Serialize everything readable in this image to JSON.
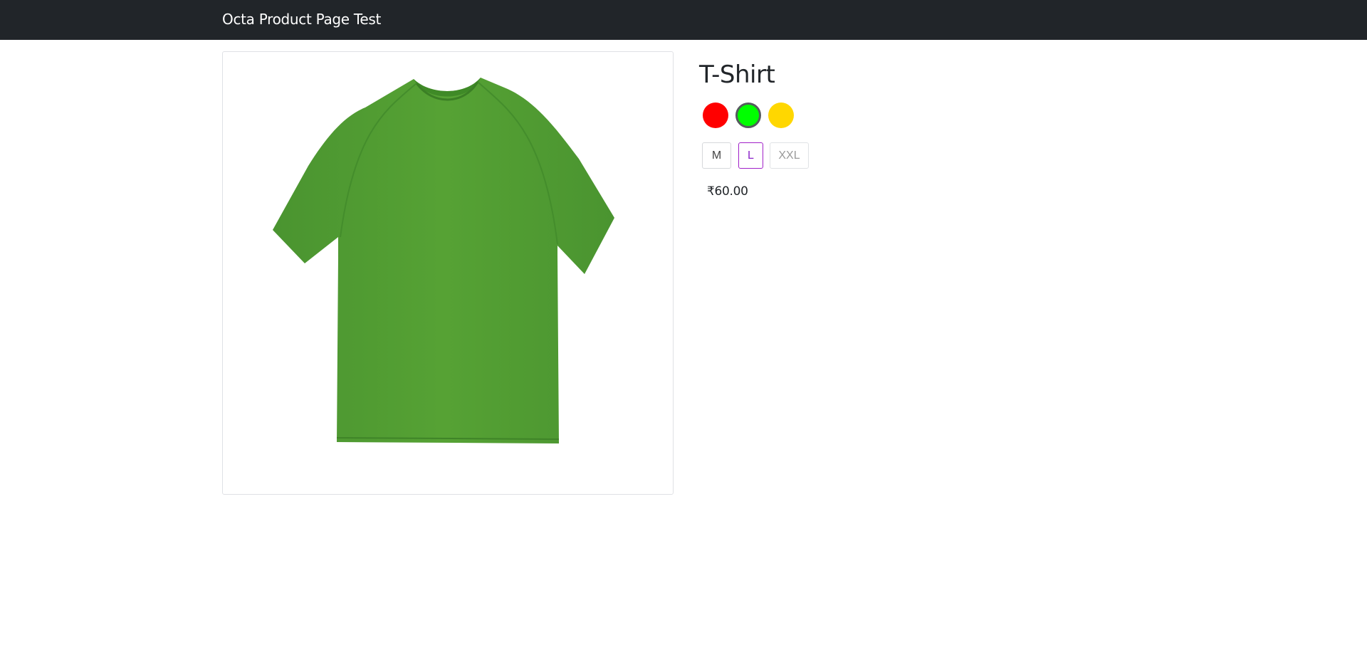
{
  "navbar": {
    "brand": "Octa Product Page Test"
  },
  "product": {
    "title": "T-Shirt",
    "image_icon": "green-tshirt-image",
    "colors": [
      {
        "name": "red",
        "hex": "#ff0000",
        "selected": false
      },
      {
        "name": "green",
        "hex": "#00ff00",
        "selected": true
      },
      {
        "name": "yellow",
        "hex": "#ffd700",
        "selected": false
      }
    ],
    "sizes": [
      {
        "label": "M",
        "selected": false,
        "disabled": false
      },
      {
        "label": "L",
        "selected": true,
        "disabled": false
      },
      {
        "label": "XXL",
        "selected": false,
        "disabled": true
      }
    ],
    "price": "₹60.00",
    "shirt_color": "#52a031",
    "selection_accent": "#a020c8",
    "navbar_color": "#212529"
  }
}
